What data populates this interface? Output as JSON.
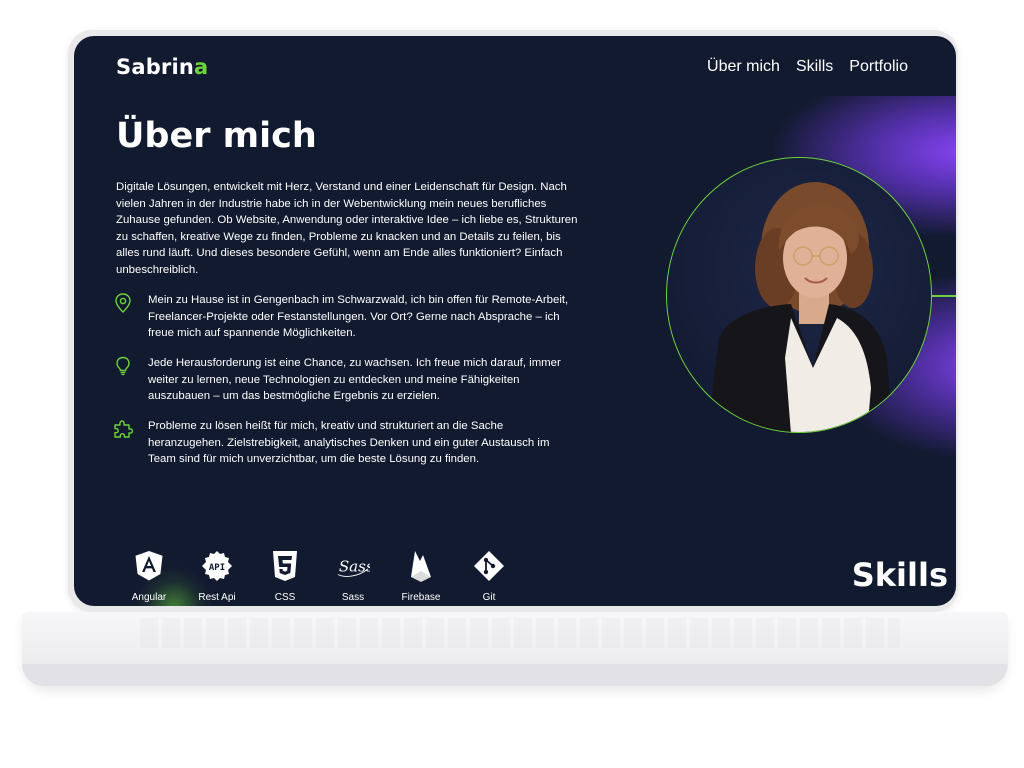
{
  "header": {
    "logo_main": "Sabrin",
    "logo_accent": "a",
    "nav": [
      "Über mich",
      "Skills",
      "Portfolio"
    ]
  },
  "about": {
    "title": "Über mich",
    "intro": "Digitale Lösungen, entwickelt mit Herz, Verstand und einer Leidenschaft für Design. Nach vielen Jahren in der Industrie habe ich in der Webentwicklung mein neues berufliches Zuhause gefunden. Ob Website, Anwendung oder interaktive Idee – ich liebe es, Strukturen zu schaffen, kreative Wege zu finden, Probleme zu knacken und an Details zu feilen, bis alles rund läuft. Und dieses besondere Gefühl, wenn am Ende alles funktioniert? Einfach unbeschreiblich.",
    "points": [
      {
        "icon": "location-pin-icon",
        "text": "Mein zu Hause ist in Gengenbach im Schwarzwald, ich bin offen für Remote-Arbeit, Freelancer-Projekte oder Festanstellungen. Vor Ort? Gerne nach Absprache – ich freue mich auf spannende Möglichkeiten."
      },
      {
        "icon": "lightbulb-icon",
        "text": "Jede Herausforderung ist eine Chance, zu wachsen. Ich freue mich darauf, immer weiter zu lernen, neue Technologien zu entdecken und meine Fähigkeiten auszubauen – um das bestmögliche Ergebnis zu erzielen."
      },
      {
        "icon": "puzzle-icon",
        "text": "Probleme zu lösen heißt für mich, kreativ und strukturiert an die Sache heranzugehen. Zielstrebigkeit, analytisches Denken und ein guter Austausch im Team sind für mich unverzichtbar, um die beste Lösung zu finden."
      }
    ]
  },
  "skills": {
    "title": "Skills",
    "items": [
      {
        "icon": "angular-icon",
        "label": "Angular"
      },
      {
        "icon": "api-icon",
        "label": "Rest Api"
      },
      {
        "icon": "css3-icon",
        "label": "CSS"
      },
      {
        "icon": "sass-icon",
        "label": "Sass"
      },
      {
        "icon": "firebase-icon",
        "label": "Firebase"
      },
      {
        "icon": "git-icon",
        "label": "Git"
      }
    ]
  },
  "colors": {
    "background": "#121a30",
    "accent_green": "#6cd33a",
    "accent_purple": "#8c46ff"
  }
}
